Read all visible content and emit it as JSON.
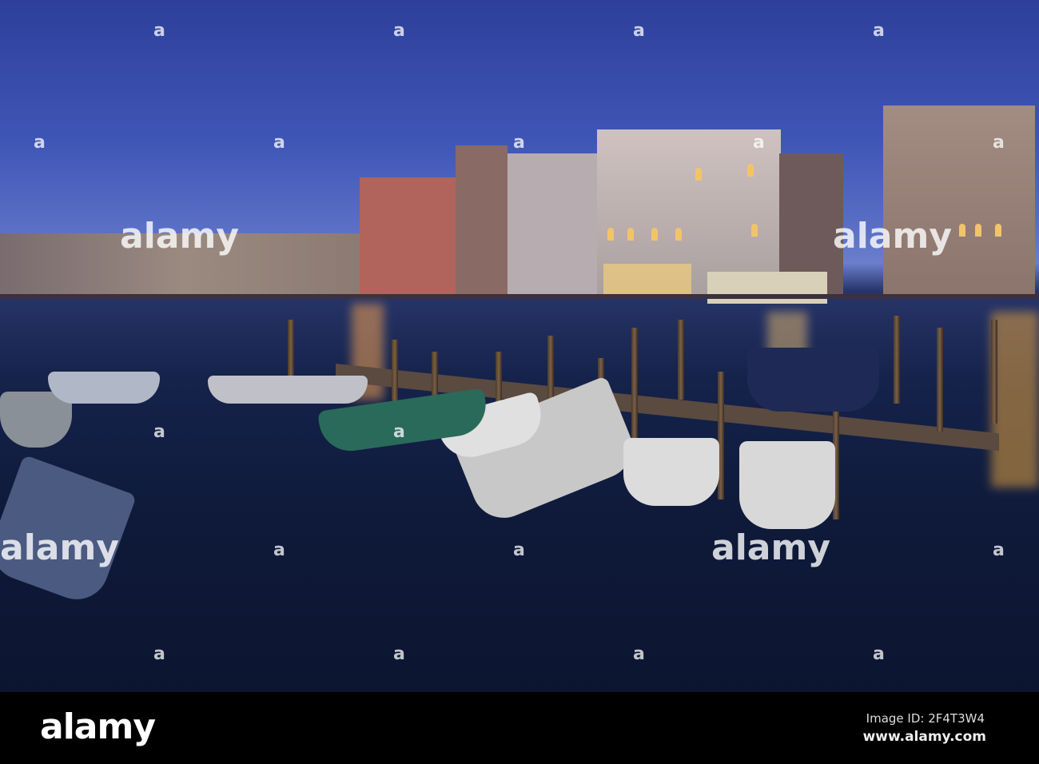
{
  "photo": {
    "subject": "Grand Canal at dusk with moored boats",
    "colors": {
      "sky": "#3f55b5",
      "water": "#15224a",
      "light": "#f2c46a"
    }
  },
  "watermark": {
    "mark": "a",
    "logo": "alamy"
  },
  "footer": {
    "logo": "alamy",
    "image_id": "Image ID: 2F4T3W4",
    "url": "www.alamy.com"
  }
}
